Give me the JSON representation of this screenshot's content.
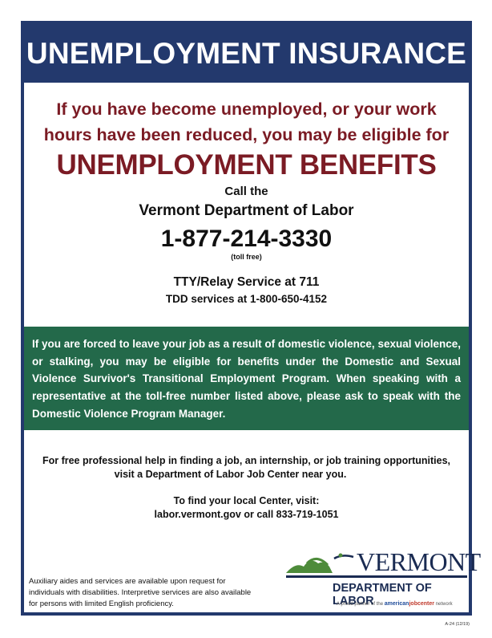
{
  "banner": {
    "title": "UNEMPLOYMENT INSURANCE"
  },
  "lead": {
    "line1": "If you have become unemployed, or your work",
    "line2": "hours have been reduced, you may be eligible for",
    "benefits": "UNEMPLOYMENT BENEFITS"
  },
  "contact": {
    "call_the": "Call the",
    "agency": "Vermont Department of Labor",
    "phone": "1-877-214-3330",
    "toll_free": "(toll free)",
    "tty": "TTY/Relay Service at 711",
    "tdd": "TDD services at 1-800-650-4152"
  },
  "domestic_violence": {
    "text": "If you are forced to leave your job as a result of domestic violence, sexual violence, or stalking, you may be eligible for benefits under the Domestic and Sexual Violence Survivor's Transitional Employment Program. When speaking with a representative at the toll-free number listed above, please ask to speak with the Domestic Violence Program Manager."
  },
  "help": {
    "line1": "For free professional help in finding a job, an internship, or job training opportunities,",
    "line2": "visit a Department of Labor Job Center near you.",
    "line3": "To find your local Center, visit:",
    "line4": "labor.vermont.gov or call 833-719-1051"
  },
  "auxiliary": {
    "text": "Auxiliary aides and services are available upon request for individuals with disabilities. Interpretive services are also available for persons with limited English proficiency."
  },
  "logo": {
    "wordmark": "VERMONT",
    "department": "DEPARTMENT OF LABOR",
    "partner_prefix": "A proud partner of the",
    "partner_a": "american",
    "partner_b": "jobcenter",
    "partner_suffix": "network",
    "icon": "green-mountains-icon",
    "colors": {
      "mountain": "#4d8b3a",
      "navy": "#1a2b52"
    }
  },
  "form_number": "A-24 (12/19)",
  "colors": {
    "navy": "#23396d",
    "maroon": "#7b1b24",
    "green": "#23694a"
  }
}
